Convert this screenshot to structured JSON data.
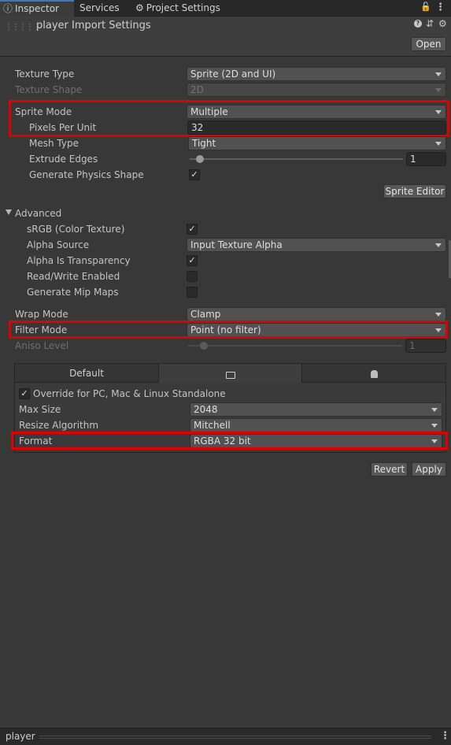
{
  "tabs": {
    "inspector": "Inspector",
    "services": "Services",
    "project_settings": "Project Settings"
  },
  "header": {
    "title": "player Import Settings",
    "open_button": "Open"
  },
  "settings": {
    "texture_type": {
      "label": "Texture Type",
      "value": "Sprite (2D and UI)"
    },
    "texture_shape": {
      "label": "Texture Shape",
      "value": "2D"
    },
    "sprite_mode": {
      "label": "Sprite Mode",
      "value": "Multiple"
    },
    "pixels_per_unit": {
      "label": "Pixels Per Unit",
      "value": "32"
    },
    "mesh_type": {
      "label": "Mesh Type",
      "value": "Tight"
    },
    "extrude_edges": {
      "label": "Extrude Edges",
      "value": "1",
      "slider_fraction": 0.06
    },
    "generate_physics_shape": {
      "label": "Generate Physics Shape",
      "checked": true
    },
    "sprite_editor_button": "Sprite Editor"
  },
  "advanced": {
    "label": "Advanced",
    "srgb": {
      "label": "sRGB (Color Texture)",
      "checked": true
    },
    "alpha_source": {
      "label": "Alpha Source",
      "value": "Input Texture Alpha"
    },
    "alpha_is_transparency": {
      "label": "Alpha Is Transparency",
      "checked": true
    },
    "read_write": {
      "label": "Read/Write Enabled",
      "checked": false
    },
    "generate_mip_maps": {
      "label": "Generate Mip Maps",
      "checked": false
    }
  },
  "wrap_mode": {
    "label": "Wrap Mode",
    "value": "Clamp"
  },
  "filter_mode": {
    "label": "Filter Mode",
    "value": "Point (no filter)"
  },
  "aniso_level": {
    "label": "Aniso Level",
    "value": "1",
    "slider_fraction": 0.07
  },
  "platform": {
    "tab_default": "Default",
    "override_label": "Override for PC, Mac & Linux Standalone",
    "override_checked": true,
    "max_size": {
      "label": "Max Size",
      "value": "2048"
    },
    "resize_algorithm": {
      "label": "Resize Algorithm",
      "value": "Mitchell"
    },
    "format": {
      "label": "Format",
      "value": "RGBA 32 bit"
    }
  },
  "actions": {
    "revert": "Revert",
    "apply": "Apply"
  },
  "footer": {
    "label": "player"
  },
  "colors": {
    "highlight": "#e00000",
    "accent": "#3a79bb"
  }
}
